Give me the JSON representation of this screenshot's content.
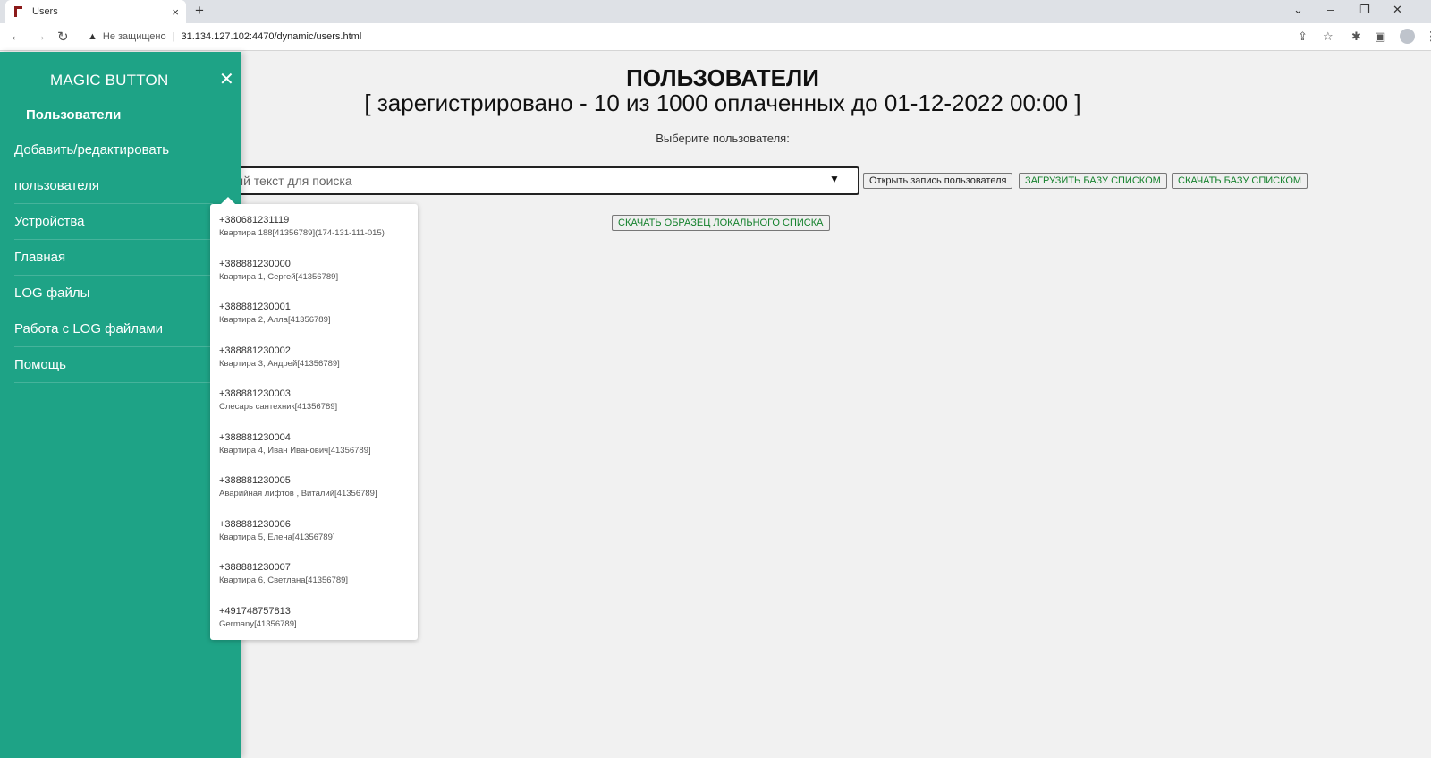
{
  "browser": {
    "tab_title": "Users",
    "tab_close": "×",
    "new_tab": "+",
    "security_label": "Не защищено",
    "url": "31.134.127.102:4470/dynamic/users.html"
  },
  "sidebar": {
    "title": "MAGIC BUTTON",
    "close": "✕",
    "active_item": "Пользователи",
    "items": [
      {
        "label": "Добавить/редактировать"
      },
      {
        "label": "пользователя"
      },
      {
        "label": "Устройства"
      },
      {
        "label": "Главная"
      },
      {
        "label": "LOG файлы"
      },
      {
        "label": "Работа с LOG файлами"
      },
      {
        "label": "Помощь"
      }
    ]
  },
  "main": {
    "heading": "ПОЛЬЗОВАТЕЛИ",
    "subheading": "[ зарегистрировано - 10 из 1000 оплаченных до 01-12-2022 00:00 ]",
    "select_label": "Выберите пользователя:",
    "search_placeholder": "ый текст для поиска",
    "buttons": {
      "open_record": "Открыть запись пользователя",
      "upload_list": "ЗАГРУЗИТЬ БАЗУ СПИСКОМ",
      "download_list": "СКАЧАТЬ БАЗУ СПИСКОМ",
      "download_sample": "СКАЧАТЬ ОБРАЗЕЦ ЛОКАЛЬНОГО СПИСКА"
    }
  },
  "dropdown": {
    "options": [
      {
        "phone": "+380681231119",
        "desc": "Квартира 188[41356789](174-131-111-015)"
      },
      {
        "phone": "+388881230000",
        "desc": "Квартира 1, Сергей[41356789]"
      },
      {
        "phone": "+388881230001",
        "desc": "Квартира 2, Алла[41356789]"
      },
      {
        "phone": "+388881230002",
        "desc": "Квартира 3, Андрей[41356789]"
      },
      {
        "phone": "+388881230003",
        "desc": "Слесарь сантехник[41356789]"
      },
      {
        "phone": "+388881230004",
        "desc": "Квартира 4, Иван Иванович[41356789]"
      },
      {
        "phone": "+388881230005",
        "desc": "Аварийная лифтов , Виталий[41356789]"
      },
      {
        "phone": "+388881230006",
        "desc": "Квартира 5, Елена[41356789]"
      },
      {
        "phone": "+388881230007",
        "desc": "Квартира 6, Светлана[41356789]"
      },
      {
        "phone": "+491748757813",
        "desc": "Germany[41356789]"
      }
    ]
  },
  "colors": {
    "sidebar_bg": "#1ea386",
    "button_text": "#14812c"
  }
}
